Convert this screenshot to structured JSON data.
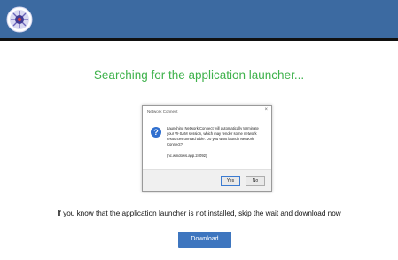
{
  "header": {
    "logo_icon": "emblem-logo-icon",
    "color": "#3c6aa1"
  },
  "main": {
    "title": "Searching for the application launcher...",
    "title_color": "#3fb24c",
    "info_text": "If you know that the application launcher is not installed, skip the wait and download now",
    "download_label": "Download",
    "accent": "#3e76bf"
  },
  "dialog": {
    "title": "Network Connect",
    "close_label": "×",
    "icon": "question-icon",
    "message": "Launching Network Connect will automatically terminate your W-SAM session, which may render some network resources unreachable. Do you want launch Network Connect?",
    "url": "(nc.windows.app.24092)",
    "yes_label": "Yes",
    "no_label": "No"
  }
}
